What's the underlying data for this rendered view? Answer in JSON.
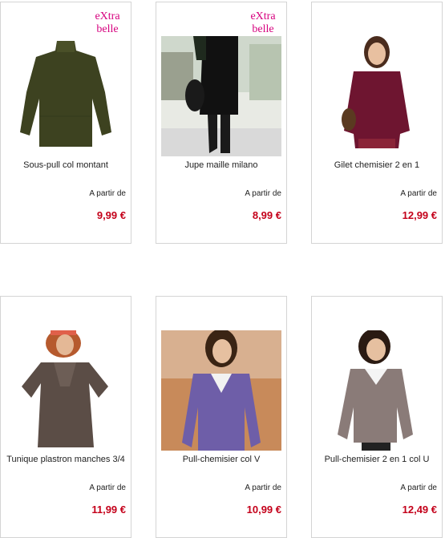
{
  "brand_logo": {
    "line1": "eXtra",
    "line2": "belle",
    "color": "#d6007e"
  },
  "products": [
    {
      "name": "Sous-pull col montant",
      "from_label": "A partir de",
      "price": "9,99 €",
      "has_brand": true,
      "image": "olive-turtleneck-sweater"
    },
    {
      "name": "Jupe maille milano",
      "from_label": "A partir de",
      "price": "8,99 €",
      "has_brand": true,
      "image": "black-knit-skirt"
    },
    {
      "name": "Gilet chemisier 2 en 1",
      "from_label": "A partir de",
      "price": "12,99 €",
      "has_brand": false,
      "image": "burgundy-cardigan"
    },
    {
      "name": "Tunique plastron manches 3/4",
      "from_label": "A partir de",
      "price": "11,99 €",
      "has_brand": false,
      "image": "grey-tunic"
    },
    {
      "name": "Pull-chemisier col V",
      "from_label": "A partir de",
      "price": "10,99 €",
      "has_brand": false,
      "image": "purple-vneck-sweater"
    },
    {
      "name": "Pull-chemisier 2 en 1 col U",
      "from_label": "A partir de",
      "price": "12,49 €",
      "has_brand": false,
      "image": "taupe-sweater"
    }
  ],
  "colors": {
    "price": "#c4001a",
    "border": "#d4d4d4"
  }
}
